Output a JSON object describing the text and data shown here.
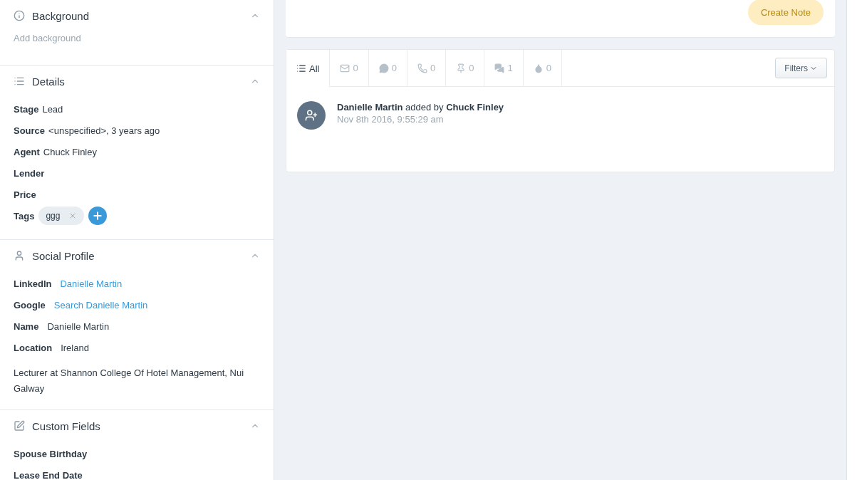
{
  "sidebar": {
    "sections": [
      {
        "kind": "background",
        "title": "Background",
        "expanded": true,
        "placeholder": "Add background"
      },
      {
        "kind": "details",
        "title": "Details",
        "expanded": true,
        "rows": [
          {
            "label": "Stage",
            "value": "Lead"
          },
          {
            "label": "Source",
            "value": "<unspecified>, 3 years ago"
          },
          {
            "label": "Agent",
            "value": "Chuck Finley"
          },
          {
            "label": "Lender"
          },
          {
            "label": "Price"
          }
        ],
        "tags": {
          "label": "Tags",
          "items": [
            "ggg"
          ]
        }
      },
      {
        "kind": "social",
        "title": "Social Profile",
        "expanded": true,
        "rows": [
          {
            "label": "LinkedIn",
            "value": "Danielle Martin",
            "link": true
          },
          {
            "label": "Google",
            "value": "Search Danielle Martin",
            "link": true
          },
          {
            "label": "Name",
            "value": "Danielle Martin",
            "link": false
          },
          {
            "label": "Location",
            "value": "Ireland",
            "link": false
          }
        ],
        "bio": "Lecturer at Shannon College Of Hotel Management, Nui Galway"
      },
      {
        "kind": "custom",
        "title": "Custom Fields",
        "expanded": true,
        "rows": [
          {
            "label": "Spouse Birthday"
          },
          {
            "label": "Lease End Date"
          }
        ]
      }
    ]
  },
  "note_card": {
    "button": {
      "label": "Create Note",
      "disabled": true
    }
  },
  "activity": {
    "tabs": [
      {
        "kind": "all",
        "label": "All",
        "selected": true
      },
      {
        "kind": "email",
        "label": "0",
        "selected": false
      },
      {
        "kind": "message",
        "label": "0",
        "selected": false
      },
      {
        "kind": "call",
        "label": "0",
        "selected": false
      },
      {
        "kind": "pin",
        "label": "0",
        "selected": false
      },
      {
        "kind": "chat",
        "label": "1",
        "selected": false
      },
      {
        "kind": "drop",
        "label": "0",
        "selected": false
      }
    ],
    "filters": "Filters",
    "events": [
      {
        "text": "**Danielle Martin** added by **Chuck Finley**",
        "time": "Nov 8th 2016, 9:55:29 am"
      }
    ]
  }
}
